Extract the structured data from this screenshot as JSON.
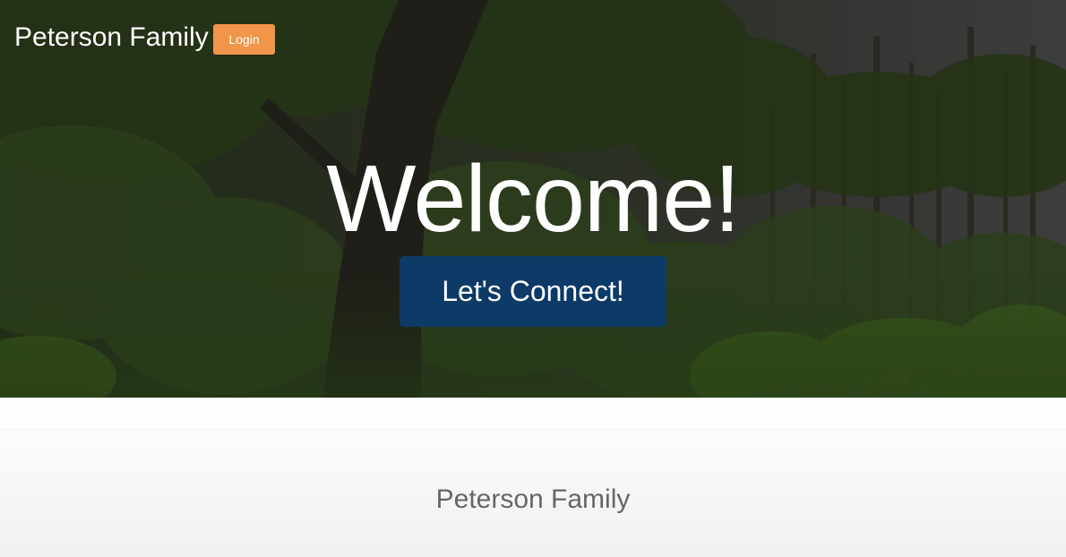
{
  "header": {
    "brand": "Peterson Family",
    "login_label": "Login"
  },
  "hero": {
    "heading": "Welcome!",
    "cta_label": "Let's Connect!"
  },
  "footer": {
    "title": "Peterson Family"
  },
  "colors": {
    "login_button": "#f0954a",
    "cta_button": "#0d3a66",
    "footer_text": "#666666"
  }
}
